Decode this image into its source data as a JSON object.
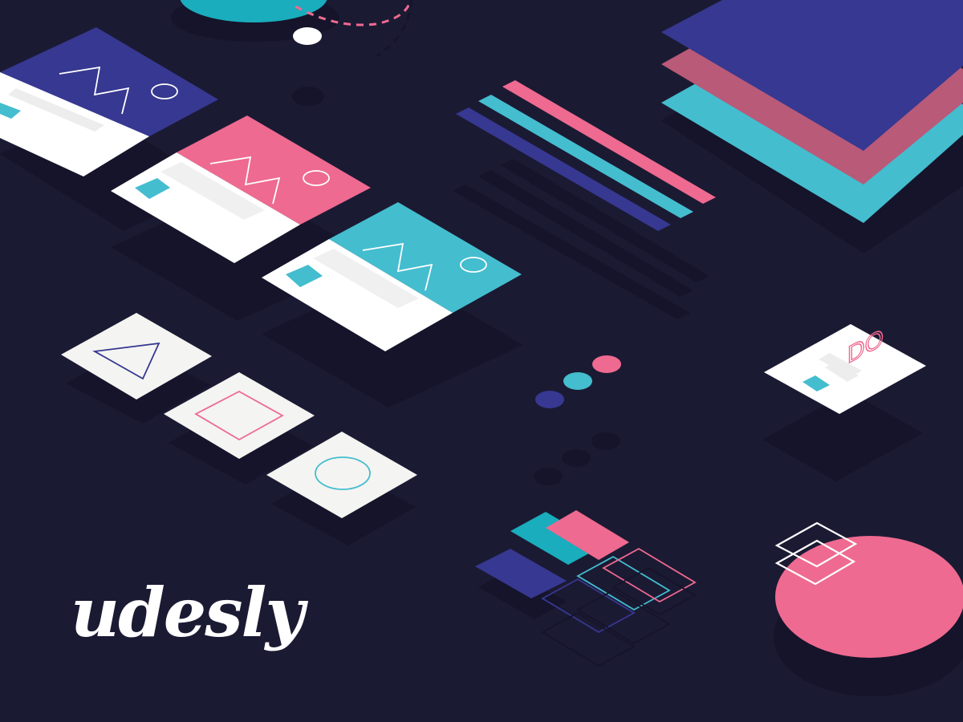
{
  "brand": {
    "logo_text": "udesly"
  },
  "card_badge": {
    "text": "DO"
  },
  "colors": {
    "background": "#1b1a33",
    "shadow": "#15142a",
    "navy": "#363891",
    "pink": "#ee6a90",
    "teal": "#44bdcf",
    "teal_dark": "#19adbd",
    "mauve": "#b95a78",
    "white": "#ffffff",
    "off_white": "#f4f4f2",
    "placeholder": "#ededed"
  },
  "illustration": {
    "cards": [
      {
        "name": "card-navy",
        "header_color": "navy"
      },
      {
        "name": "card-pink",
        "header_color": "pink"
      },
      {
        "name": "card-teal",
        "header_color": "teal"
      }
    ],
    "shape_tiles": [
      {
        "name": "tile-triangle",
        "icon": "triangle-outline-icon",
        "stroke": "navy"
      },
      {
        "name": "tile-square",
        "icon": "square-outline-icon",
        "stroke": "pink"
      },
      {
        "name": "tile-circle",
        "icon": "circle-outline-icon",
        "stroke": "teal"
      }
    ],
    "stripes": [
      "pink",
      "teal",
      "navy"
    ],
    "layer_stack": [
      "teal",
      "mauve",
      "navy"
    ],
    "dots": [
      "pink",
      "teal",
      "navy"
    ],
    "palette_filled": [
      "pink",
      "teal_dark",
      "navy"
    ],
    "palette_outlined": [
      "pink",
      "teal",
      "navy"
    ]
  }
}
